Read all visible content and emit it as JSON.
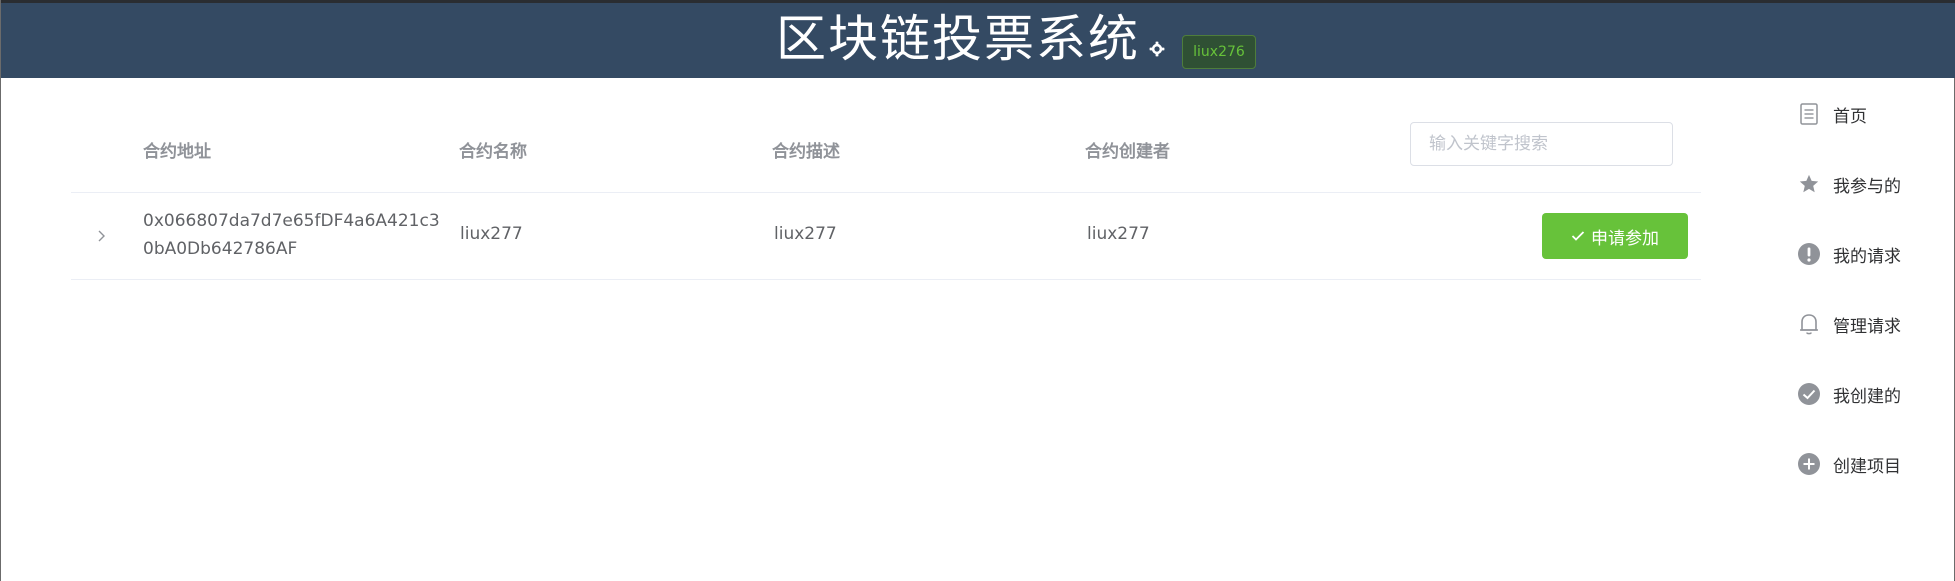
{
  "header": {
    "title": "区块链投票系统",
    "user": "liux276"
  },
  "table": {
    "columns": [
      "合约地址",
      "合约名称",
      "合约描述",
      "合约创建者"
    ],
    "search_placeholder": "输入关键字搜索",
    "rows": [
      {
        "address": "0x066807da7d7e65fDF4a6A421c30bA0Db642786AF",
        "name": "liux277",
        "description": "liux277",
        "creator": "liux277",
        "action_label": "申请参加"
      }
    ]
  },
  "sidebar": {
    "items": [
      {
        "label": "首页",
        "icon": "document-icon"
      },
      {
        "label": "我参与的",
        "icon": "star-icon"
      },
      {
        "label": "我的请求",
        "icon": "exclamation-icon"
      },
      {
        "label": "管理请求",
        "icon": "bell-icon"
      },
      {
        "label": "我创建的",
        "icon": "check-circle-icon"
      },
      {
        "label": "创建项目",
        "icon": "plus-circle-icon"
      }
    ]
  },
  "colors": {
    "header_bg": "#344a63",
    "success": "#67c23a",
    "icon_gray": "#909399"
  }
}
